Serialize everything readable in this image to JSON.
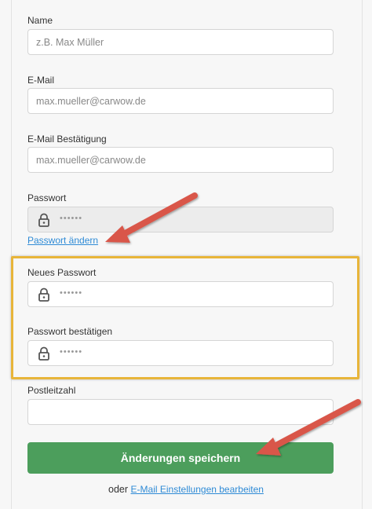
{
  "form": {
    "name_label": "Name",
    "name_placeholder": "z.B. Max Müller",
    "email_label": "E-Mail",
    "email_value": "max.mueller@carwow.de",
    "email_confirm_label": "E-Mail Bestätigung",
    "email_confirm_value": "max.mueller@carwow.de",
    "password_label": "Passwort",
    "password_value": "••••••",
    "change_password_link": "Passwort ändern",
    "new_password_label": "Neues Passwort",
    "new_password_value": "••••••",
    "confirm_password_label": "Passwort bestätigen",
    "confirm_password_value": "••••••",
    "postcode_label": "Postleitzahl",
    "postcode_value": "",
    "save_button": "Änderungen speichern",
    "bottom_prefix": "oder",
    "email_settings_link": "E-Mail Einstellungen bearbeiten"
  },
  "colors": {
    "accent_green": "#4c9e5c",
    "link_blue": "#2f8bd6",
    "highlight_yellow": "#e8b53a",
    "arrow_red": "#d9564a"
  },
  "icons": [
    "lock-icon",
    "arrow-annotation"
  ]
}
